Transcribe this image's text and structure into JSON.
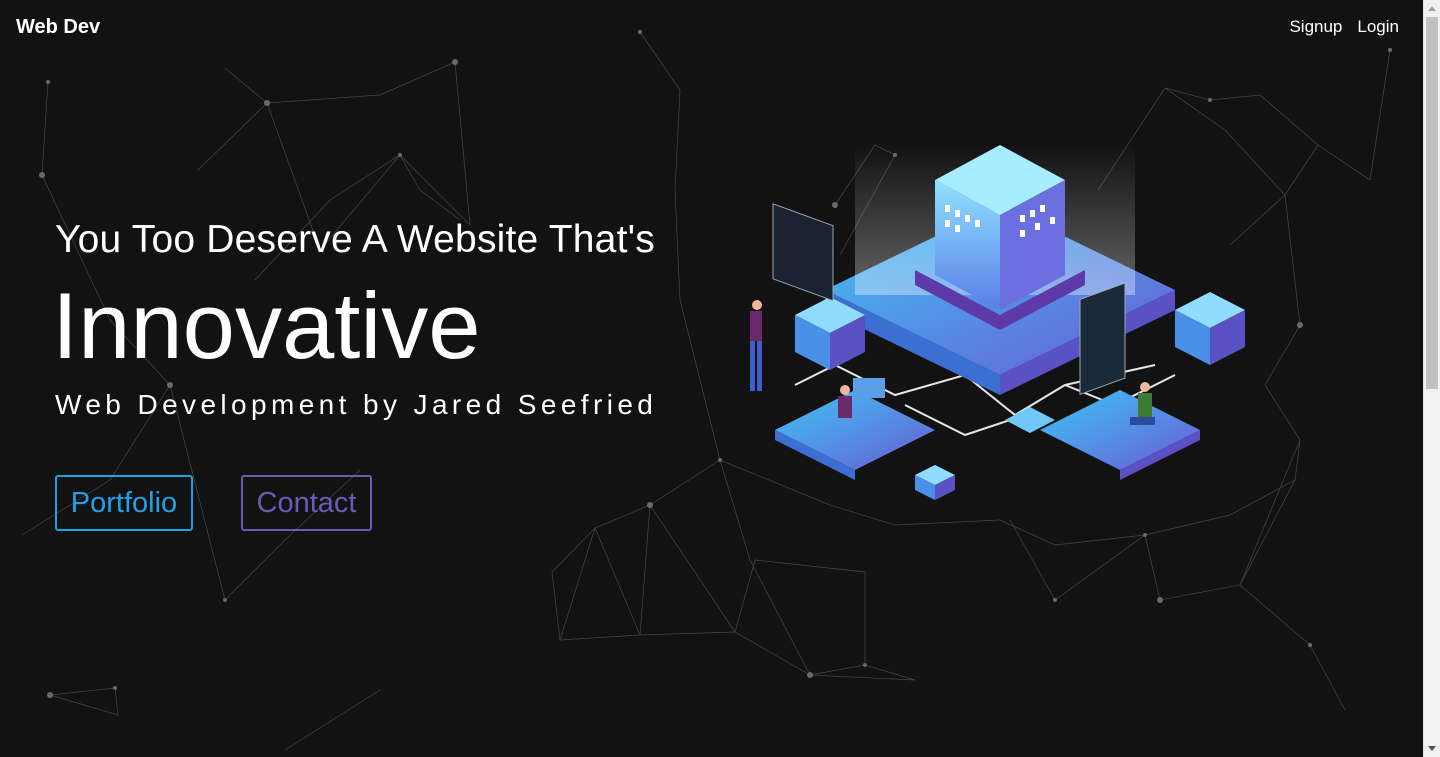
{
  "navbar": {
    "brand": "Web Dev",
    "links": [
      "Signup",
      "Login"
    ]
  },
  "hero": {
    "headline": "You Too Deserve A Website That's",
    "big_word": "Innovative",
    "tagline": "Web Development by Jared Seefried"
  },
  "buttons": {
    "portfolio": "Portfolio",
    "contact": "Contact"
  },
  "colors": {
    "background": "#121212",
    "portfolio_accent": "#1fa2e8",
    "contact_accent": "#6a5bb5",
    "text": "#ffffff"
  },
  "icons": {
    "illustration": "isometric-server-illustration"
  }
}
